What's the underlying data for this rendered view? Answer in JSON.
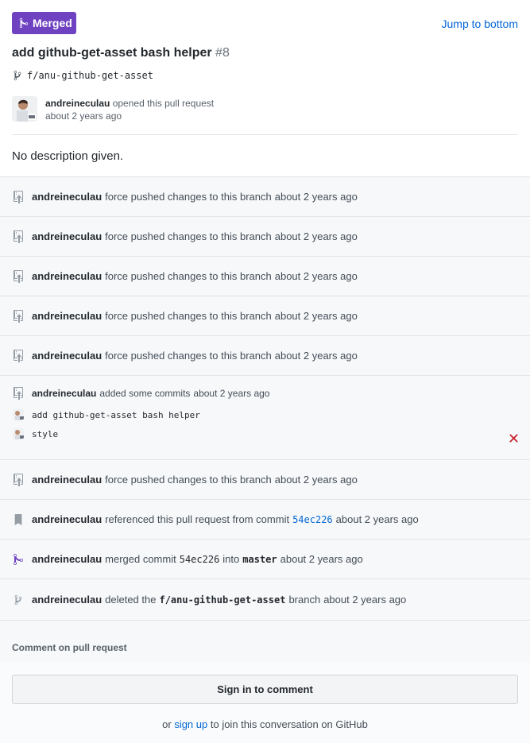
{
  "header": {
    "badge_label": "Merged",
    "jump_label": "Jump to bottom",
    "title": "add github-get-asset bash helper",
    "number": "#8",
    "branch": "f/anu-github-get-asset",
    "opener_user": "andreineculau",
    "opener_action": "opened this pull request",
    "opener_time": "about 2 years ago",
    "description": "No description given."
  },
  "events": {
    "fp1": {
      "user": "andreineculau",
      "action": "force pushed changes to this branch",
      "time": "about 2 years ago"
    },
    "fp2": {
      "user": "andreineculau",
      "action": "force pushed changes to this branch",
      "time": "about 2 years ago"
    },
    "fp3": {
      "user": "andreineculau",
      "action": "force pushed changes to this branch",
      "time": "about 2 years ago"
    },
    "fp4": {
      "user": "andreineculau",
      "action": "force pushed changes to this branch",
      "time": "about 2 years ago"
    },
    "fp5": {
      "user": "andreineculau",
      "action": "force pushed changes to this branch",
      "time": "about 2 years ago"
    },
    "commits": {
      "user": "andreineculau",
      "action": "added some commits",
      "time": "about 2 years ago",
      "items": [
        {
          "message": "add github-get-asset bash helper"
        },
        {
          "message": "style"
        }
      ]
    },
    "fp6": {
      "user": "andreineculau",
      "action": "force pushed changes to this branch",
      "time": "about 2 years ago"
    },
    "ref": {
      "user": "andreineculau",
      "action": "referenced this pull request from commit",
      "sha": "54ec226",
      "time": "about 2 years ago"
    },
    "merged": {
      "user": "andreineculau",
      "action": "merged commit",
      "sha": "54ec226",
      "into": "into",
      "target": "master",
      "time": "about 2 years ago"
    },
    "deleted": {
      "user": "andreineculau",
      "action": "deleted the",
      "branch": "f/anu-github-get-asset",
      "suffix": "branch",
      "time": "about 2 years ago"
    }
  },
  "comment": {
    "label": "Comment on pull request",
    "signin_label": "Sign in to comment",
    "footer_prefix": "or",
    "footer_link": "sign up",
    "footer_suffix": "to join this conversation on GitHub"
  },
  "colors": {
    "merged": "#6f42c1",
    "link": "#0366d6",
    "fail": "#cb2431"
  },
  "icons": [
    "git-merge-icon",
    "git-branch-icon",
    "repo-push-icon",
    "bookmark-icon",
    "x-icon"
  ]
}
